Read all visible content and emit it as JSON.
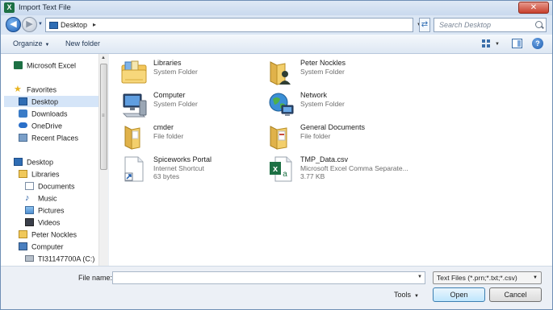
{
  "window": {
    "title": "Import Text File",
    "app_icon_letter": "X"
  },
  "address": {
    "path": "Desktop",
    "search_placeholder": "Search Desktop"
  },
  "toolbar": {
    "organize": "Organize",
    "new_folder": "New folder"
  },
  "nav": {
    "items": [
      {
        "label": "Microsoft Excel",
        "icon": "excel-icon"
      },
      {
        "label": "Favorites",
        "icon": "star-icon"
      },
      {
        "label": "Desktop",
        "icon": "desktop-icon",
        "selected": true
      },
      {
        "label": "Downloads",
        "icon": "downloads-icon"
      },
      {
        "label": "OneDrive",
        "icon": "cloud-icon"
      },
      {
        "label": "Recent Places",
        "icon": "recent-places-icon"
      },
      {
        "label": "Desktop",
        "icon": "desktop-icon"
      },
      {
        "label": "Libraries",
        "icon": "libraries-icon"
      },
      {
        "label": "Documents",
        "icon": "documents-icon"
      },
      {
        "label": "Music",
        "icon": "music-icon"
      },
      {
        "label": "Pictures",
        "icon": "pictures-icon"
      },
      {
        "label": "Videos",
        "icon": "videos-icon"
      },
      {
        "label": "Peter Nockles",
        "icon": "user-folder-icon"
      },
      {
        "label": "Computer",
        "icon": "computer-icon"
      },
      {
        "label": "TI31147700A (C:)",
        "icon": "drive-icon"
      }
    ]
  },
  "files": [
    {
      "name": "Libraries",
      "type": "System Folder",
      "icon": "libraries-folder-icon"
    },
    {
      "name": "Peter Nockles",
      "type": "System Folder",
      "icon": "user-folder-icon"
    },
    {
      "name": "Computer",
      "type": "System Folder",
      "icon": "computer-icon"
    },
    {
      "name": "Network",
      "type": "System Folder",
      "icon": "network-icon"
    },
    {
      "name": "cmder",
      "type": "File folder",
      "icon": "folder-icon"
    },
    {
      "name": "General Documents",
      "type": "File folder",
      "icon": "folder-icon"
    },
    {
      "name": "Spiceworks Portal",
      "type": "Internet Shortcut",
      "size": "63 bytes",
      "icon": "shortcut-icon"
    },
    {
      "name": "TMP_Data.csv",
      "type": "Microsoft Excel Comma Separate...",
      "size": "3.77 KB",
      "icon": "excel-csv-icon"
    }
  ],
  "bottom": {
    "file_name_label": "File name:",
    "file_name_value": "",
    "file_type": "Text Files (*.prn;*.txt;*.csv)",
    "tools": "Tools",
    "open": "Open",
    "cancel": "Cancel"
  },
  "colors": {
    "accent": "#2f6db4",
    "excel_green": "#1d7044",
    "selection": "#d5e5f8",
    "close_red": "#c8402c"
  }
}
